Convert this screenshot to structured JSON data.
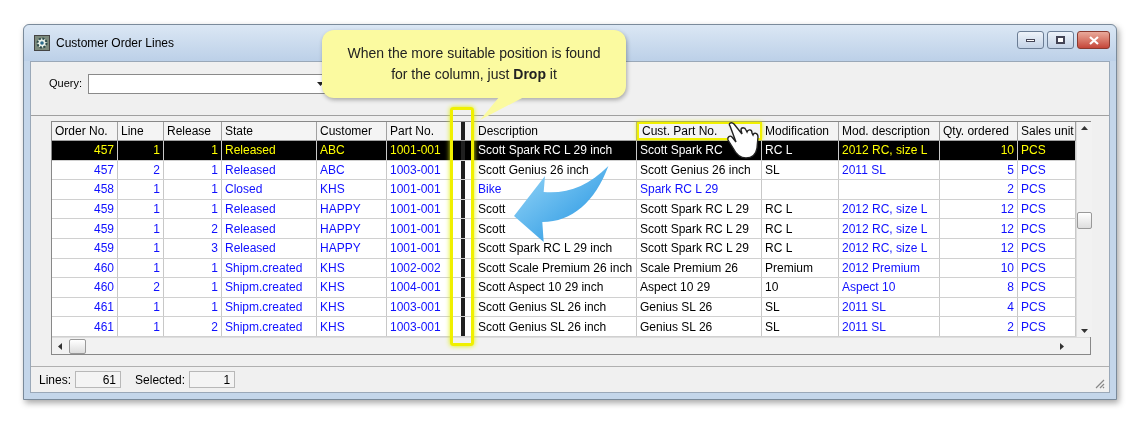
{
  "window": {
    "title": "Customer Order Lines"
  },
  "query": {
    "label": "Query:"
  },
  "callout": {
    "text": "When the more suitable position is found for the column, just **Drop** it"
  },
  "table": {
    "columns": [
      {
        "label": "Order No.",
        "kind": "number",
        "dragged": false
      },
      {
        "label": "Line",
        "kind": "number",
        "dragged": false
      },
      {
        "label": "Release",
        "kind": "number",
        "dragged": false
      },
      {
        "label": "State",
        "kind": "accent",
        "dragged": false
      },
      {
        "label": "Customer",
        "kind": "accent",
        "dragged": false
      },
      {
        "label": "Part No.",
        "kind": "accent",
        "dragged": false
      },
      {
        "label": "Description",
        "kind": "plain",
        "dragged": false
      },
      {
        "label": "Cust. Part No.",
        "kind": "plain",
        "dragged": true
      },
      {
        "label": "Modification",
        "kind": "plain",
        "dragged": false
      },
      {
        "label": "Mod. description",
        "kind": "accent",
        "dragged": false
      },
      {
        "label": "Qty. ordered",
        "kind": "number",
        "dragged": false
      },
      {
        "label": "Sales unit",
        "kind": "accent",
        "dragged": false
      }
    ],
    "rows": [
      {
        "selected": true,
        "kind": "open",
        "cells": [
          "457",
          "1",
          "1",
          "Released",
          "ABC",
          "1001-001",
          "Scott Spark RC L 29 inch",
          "Scott Spark RC",
          "RC L",
          "2012 RC, size L",
          "10",
          "PCS"
        ]
      },
      {
        "selected": false,
        "kind": "open",
        "cells": [
          "457",
          "2",
          "1",
          "Released",
          "ABC",
          "1003-001",
          "Scott Genius 26 inch",
          "Scott Genius 26 inch",
          "SL",
          "2011 SL",
          "5",
          "PCS"
        ]
      },
      {
        "selected": false,
        "kind": "closed",
        "cells": [
          "458",
          "1",
          "1",
          "Closed",
          "KHS",
          "1001-001",
          "Bike",
          "Spark RC L 29",
          null,
          null,
          "2",
          "PCS"
        ]
      },
      {
        "selected": false,
        "kind": "open",
        "cells": [
          "459",
          "1",
          "1",
          "Released",
          "HAPPY",
          "1001-001",
          "Scott",
          "Scott Spark RC L 29",
          "RC L",
          "2012 RC, size L",
          "12",
          "PCS"
        ]
      },
      {
        "selected": false,
        "kind": "open",
        "cells": [
          "459",
          "1",
          "2",
          "Released",
          "HAPPY",
          "1001-001",
          "Scott",
          "Scott Spark RC L 29",
          "RC L",
          "2012 RC, size L",
          "12",
          "PCS"
        ]
      },
      {
        "selected": false,
        "kind": "open",
        "cells": [
          "459",
          "1",
          "3",
          "Released",
          "HAPPY",
          "1001-001",
          "Scott Spark RC L 29 inch",
          "Scott Spark RC L 29",
          "RC L",
          "2012 RC, size L",
          "12",
          "PCS"
        ]
      },
      {
        "selected": false,
        "kind": "open",
        "cells": [
          "460",
          "1",
          "1",
          "Shipm.created",
          "KHS",
          "1002-002",
          "Scott Scale Premium 26 inch",
          "Scale Premium 26",
          "Premium",
          "2012 Premium",
          "10",
          "PCS"
        ]
      },
      {
        "selected": false,
        "kind": "open",
        "cells": [
          "460",
          "2",
          "1",
          "Shipm.created",
          "KHS",
          "1004-001",
          "Scott Aspect 10 29 inch",
          "Aspect 10 29",
          "10",
          "Aspect 10",
          "8",
          "PCS"
        ]
      },
      {
        "selected": false,
        "kind": "open",
        "cells": [
          "461",
          "1",
          "1",
          "Shipm.created",
          "KHS",
          "1003-001",
          "Scott Genius SL 26 inch",
          "Genius SL 26",
          "SL",
          "2011 SL",
          "4",
          "PCS"
        ]
      },
      {
        "selected": false,
        "kind": "open",
        "cells": [
          "461",
          "1",
          "2",
          "Shipm.created",
          "KHS",
          "1003-001",
          "Scott Genius SL 26 inch",
          "Genius SL 26",
          "SL",
          "2011 SL",
          "2",
          "PCS"
        ]
      }
    ]
  },
  "status_bar": {
    "fields": [
      {
        "label": "Lines:",
        "value": "61"
      },
      {
        "label": "Selected:",
        "value": "1"
      }
    ]
  }
}
